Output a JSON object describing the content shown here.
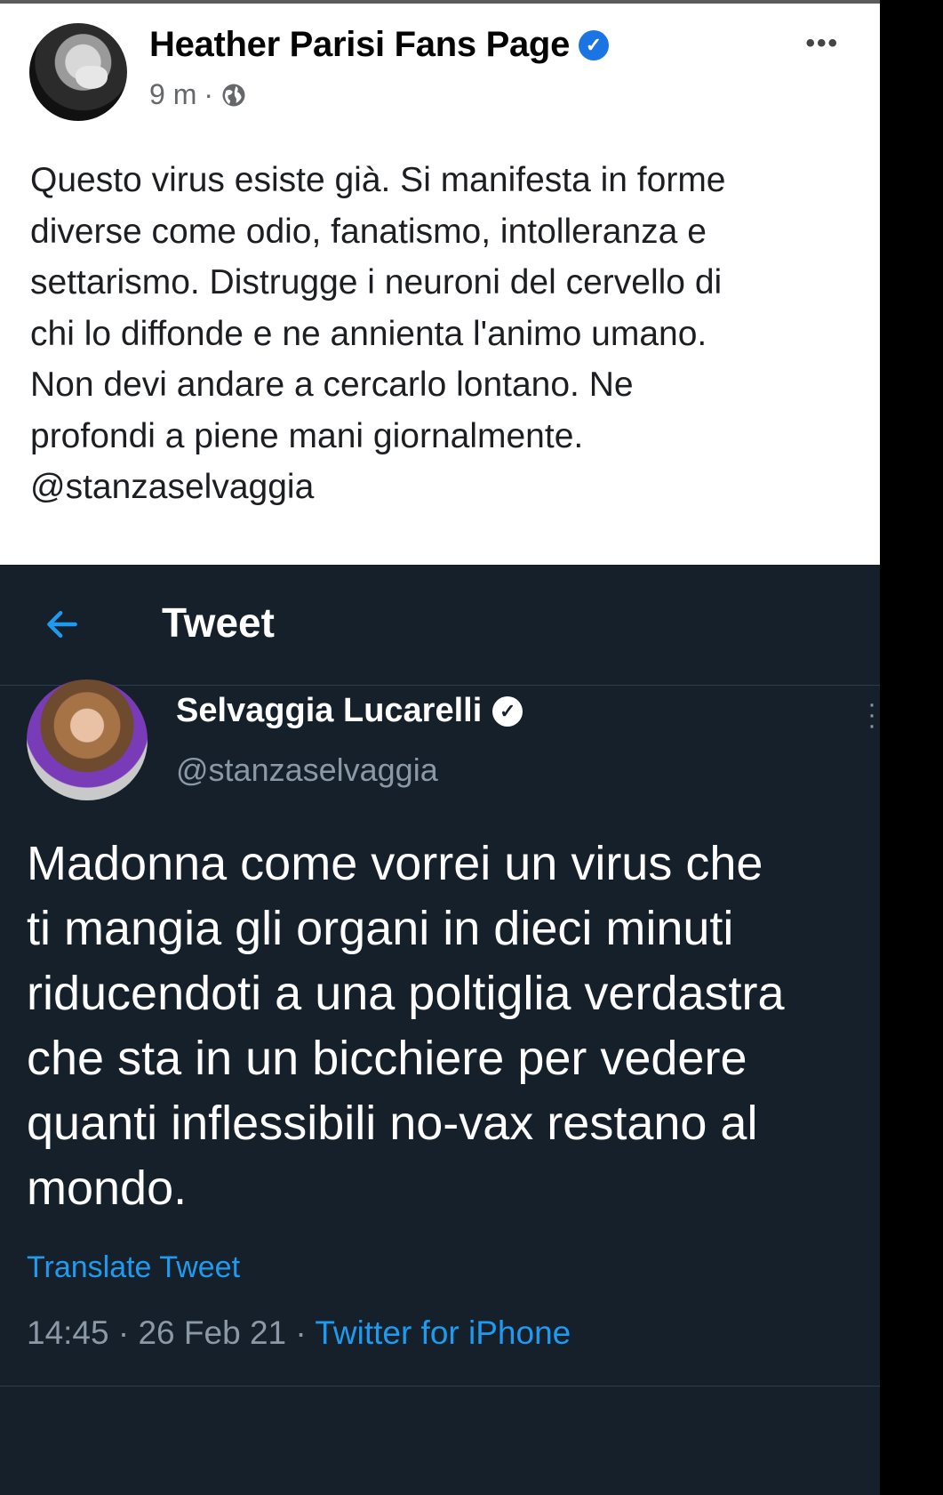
{
  "facebook_post": {
    "page_name": "Heather Parisi Fans Page",
    "time": "9 m",
    "separator": "·",
    "more_icon": "•••",
    "text": "Questo virus esiste già. Si manifesta in forme\ndiverse come odio, fanatismo, intolleranza e\nsettarismo. Distrugge i neuroni del cervello di\nchi lo diffonde e ne annienta l'animo umano.\nNon devi andare a cercarlo lontano. Ne\nprofondi a piene mani giornalmente.\n@stanzaselvaggia",
    "verified_icon": "verified-badge-icon",
    "privacy_icon": "globe-icon"
  },
  "tweet": {
    "header_title": "Tweet",
    "back_icon": "back-arrow-icon",
    "author_name": "Selvaggia Lucarelli",
    "author_handle": "@stanzaselvaggia",
    "text": "Madonna come vorrei un virus che\nti mangia gli organi in dieci minuti\nriducendoti a una poltiglia verdastra\nche sta in un bicchiere per vedere\nquanti inflessibili no-vax restano al\nmondo.",
    "translate_label": "Translate Tweet",
    "timestamp": "14:45 · 26 Feb 21 · ",
    "source": "Twitter for iPhone",
    "more_icon": "⋮"
  },
  "colors": {
    "facebook_blue": "#1b74e4",
    "twitter_bg": "#15202b",
    "twitter_blue": "#1d9bf0",
    "twitter_gray": "#8b98a5"
  }
}
